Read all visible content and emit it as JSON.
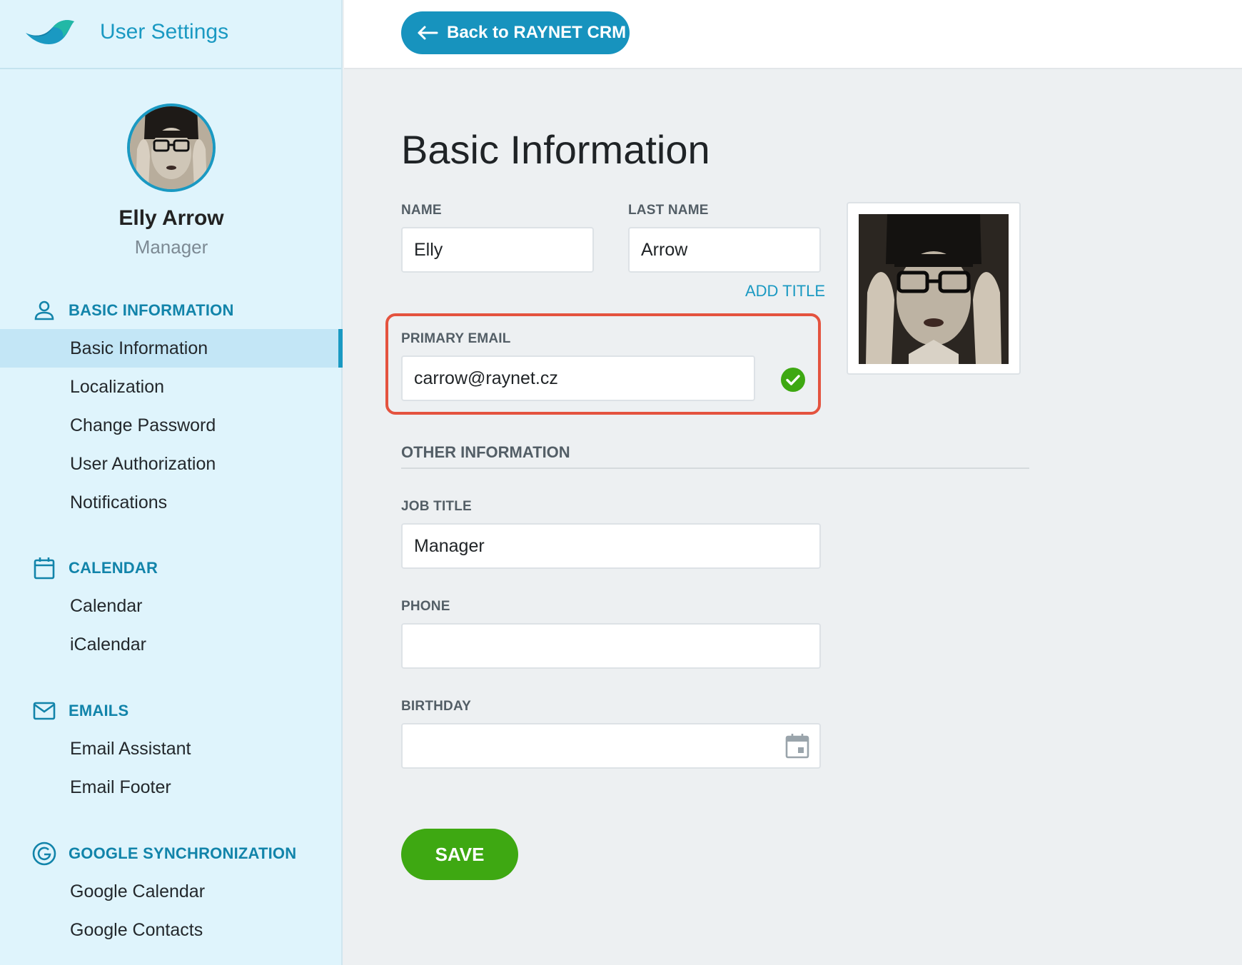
{
  "app": {
    "title": "User Settings"
  },
  "profile": {
    "name": "Elly Arrow",
    "role": "Manager"
  },
  "sidebar": {
    "sections": [
      {
        "heading": "BASIC INFORMATION",
        "icon": "user-icon",
        "items": [
          "Basic Information",
          "Localization",
          "Change Password",
          "User Authorization",
          "Notifications"
        ]
      },
      {
        "heading": "CALENDAR",
        "icon": "calendar-icon",
        "items": [
          "Calendar",
          "iCalendar"
        ]
      },
      {
        "heading": "EMAILS",
        "icon": "mail-icon",
        "items": [
          "Email Assistant",
          "Email Footer"
        ]
      },
      {
        "heading": "GOOGLE SYNCHRONIZATION",
        "icon": "google-icon",
        "items": [
          "Google Calendar",
          "Google Contacts"
        ]
      }
    ],
    "active_item": "Basic Information"
  },
  "topbar": {
    "back_label": "Back to RAYNET CRM",
    "back_icon": "arrow-left-icon"
  },
  "main": {
    "title": "Basic Information",
    "name": {
      "label": "NAME",
      "value": "Elly"
    },
    "last_name": {
      "label": "LAST NAME",
      "value": "Arrow"
    },
    "add_title": "ADD TITLE",
    "primary_email": {
      "label": "PRIMARY EMAIL",
      "value": "carrow@raynet.cz",
      "status_icon": "check-circle-icon"
    },
    "other_section": "OTHER INFORMATION",
    "job_title": {
      "label": "JOB TITLE",
      "value": "Manager"
    },
    "phone": {
      "label": "PHONE",
      "value": ""
    },
    "birthday": {
      "label": "BIRTHDAY",
      "value": "",
      "icon": "calendar-icon"
    },
    "save_label": "SAVE"
  },
  "colors": {
    "accent": "#1a99c2",
    "sidebar_bg": "#dff4fc",
    "save_green": "#3ea812",
    "highlight_red": "#e4533f",
    "check_green": "#3ea812"
  }
}
